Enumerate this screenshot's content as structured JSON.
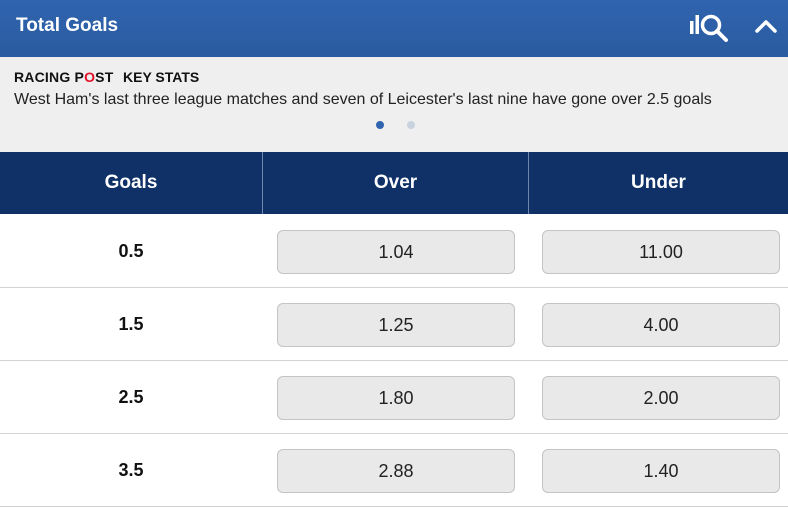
{
  "header": {
    "title": "Total Goals",
    "stats_icon": "stats-magnifier-icon",
    "collapse_icon": "chevron-up-icon"
  },
  "key_stats": {
    "brand_part1": "RACING P",
    "brand_accent": "O",
    "brand_part2": "ST",
    "label": "KEY STATS",
    "text": "West Ham's last three league matches and seven of Leicester's last nine have gone over 2.5 goals",
    "active_slide": 1,
    "slide_count": 2
  },
  "table": {
    "headers": {
      "goals": "Goals",
      "over": "Over",
      "under": "Under"
    },
    "rows": [
      {
        "goals": "0.5",
        "over": "1.04",
        "under": "11.00"
      },
      {
        "goals": "1.5",
        "over": "1.25",
        "under": "4.00"
      },
      {
        "goals": "2.5",
        "over": "1.80",
        "under": "2.00"
      },
      {
        "goals": "3.5",
        "over": "2.88",
        "under": "1.40"
      }
    ]
  },
  "colors": {
    "header_bg": "#2f64ae",
    "column_header_bg": "#0f3167",
    "brand_accent": "#e30f26"
  }
}
